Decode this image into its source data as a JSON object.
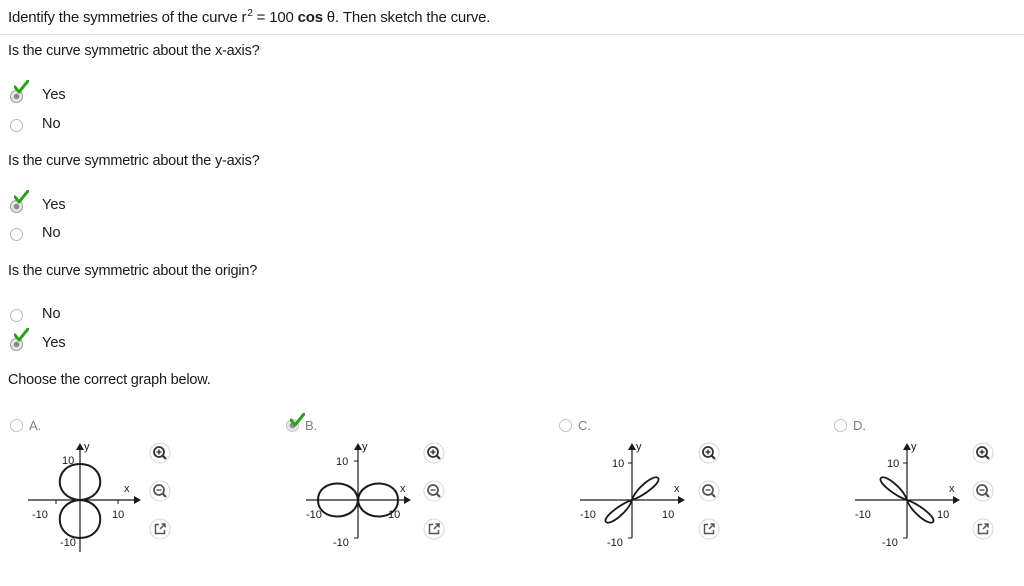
{
  "prompt": {
    "prefix": "Identify the symmetries of the curve r",
    "exponent": "2",
    "middle": " = 100 ",
    "cos": "cos",
    "suffix": " θ. Then sketch the curve."
  },
  "questions": [
    {
      "text": "Is the curve symmetric about the x-axis?",
      "options": [
        {
          "label": "Yes",
          "selected": true
        },
        {
          "label": "No",
          "selected": false
        }
      ]
    },
    {
      "text": "Is the curve symmetric about the y-axis?",
      "options": [
        {
          "label": "Yes",
          "selected": true
        },
        {
          "label": "No",
          "selected": false
        }
      ]
    },
    {
      "text": "Is the curve symmetric about the origin?",
      "options": [
        {
          "label": "No",
          "selected": false
        },
        {
          "label": "Yes",
          "selected": true
        }
      ]
    }
  ],
  "graph_prompt": "Choose the correct graph below.",
  "graph_options": [
    {
      "letter": "A.",
      "selected": false,
      "curve": "vertical-lobes"
    },
    {
      "letter": "B.",
      "selected": true,
      "curve": "horizontal-lobes"
    },
    {
      "letter": "C.",
      "selected": false,
      "curve": "diagonal-lobes-rising"
    },
    {
      "letter": "D.",
      "selected": false,
      "curve": "diagonal-lobes-falling"
    }
  ],
  "axis": {
    "x": "x",
    "y": "y",
    "pos": "10",
    "neg": "-10"
  },
  "icons": {
    "zoom_in": "zoom-in-icon",
    "zoom_out": "zoom-out-icon",
    "popout": "popout-icon",
    "check": "check-icon"
  },
  "colors": {
    "check_green": "#2e9e1f",
    "icon_gray": "#555555",
    "divider": "#dcdcdc"
  }
}
